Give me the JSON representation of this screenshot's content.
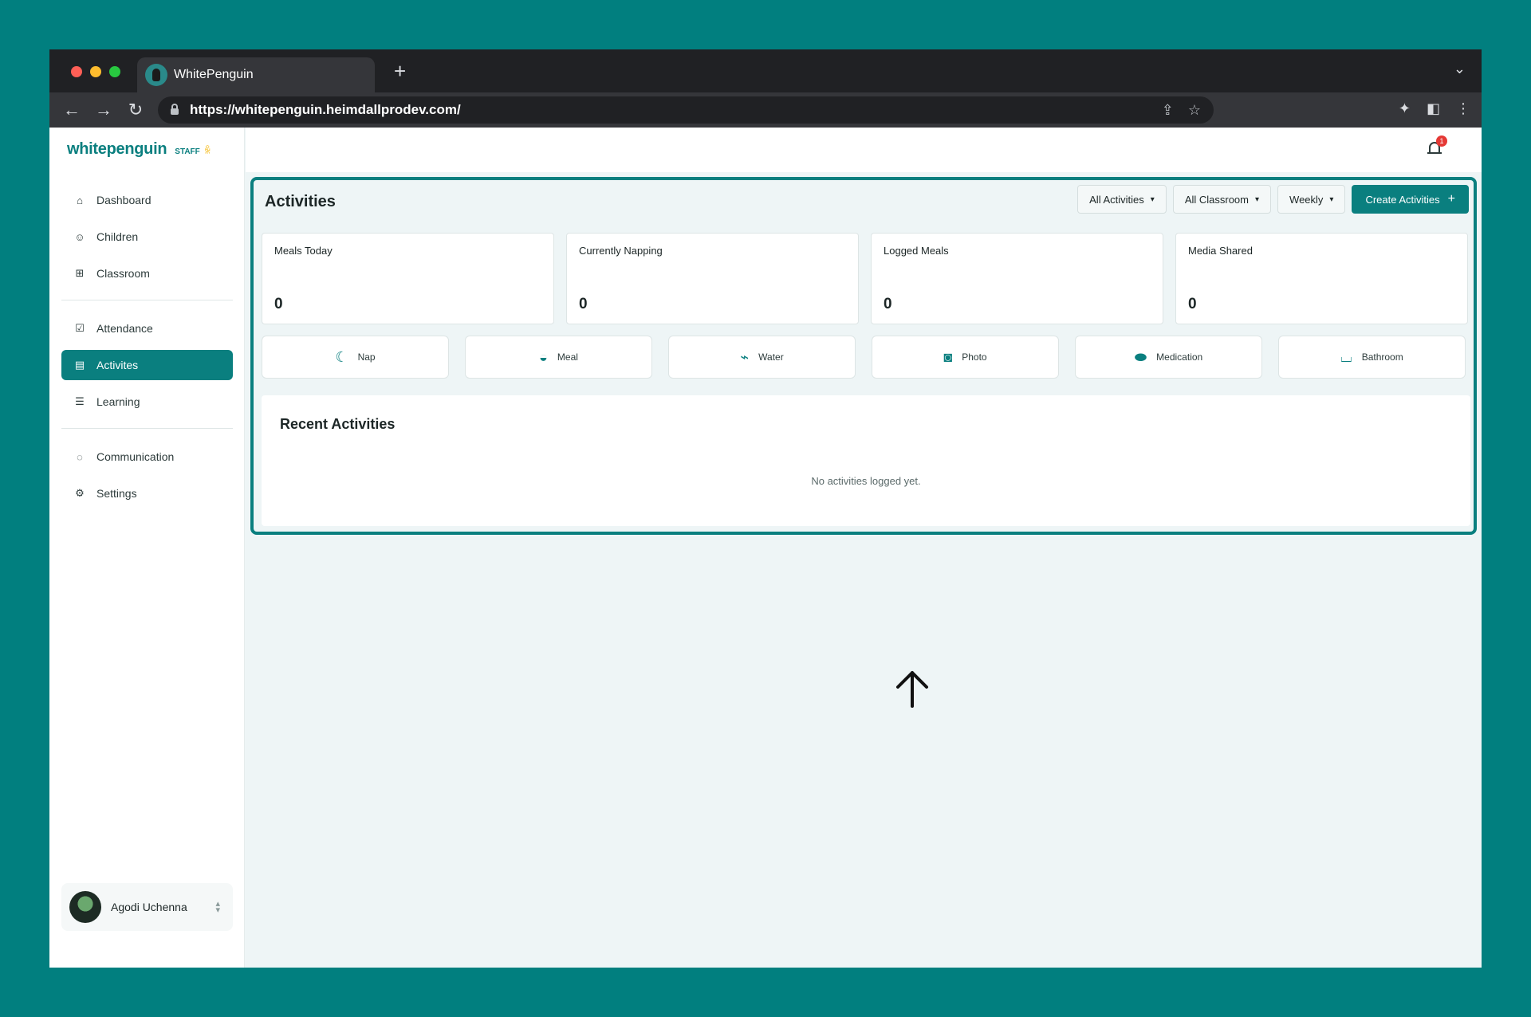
{
  "browser": {
    "tab_title": "WhitePenguin",
    "url": "https://whitepenguin.heimdallprodev.com/"
  },
  "brand": {
    "logo": "whitepenguin",
    "role": "STAFF",
    "accent": "#0a7f7f"
  },
  "sidebar": {
    "items": [
      {
        "label": "Dashboard",
        "icon": "home-icon"
      },
      {
        "label": "Children",
        "icon": "child-icon"
      },
      {
        "label": "Classroom",
        "icon": "grid-icon"
      },
      {
        "label": "Attendance",
        "icon": "checkbox-icon"
      },
      {
        "label": "Activites",
        "icon": "clipboard-icon",
        "active": true
      },
      {
        "label": "Learning",
        "icon": "book-icon"
      },
      {
        "label": "Communication",
        "icon": "chat-icon"
      },
      {
        "label": "Settings",
        "icon": "gear-icon"
      }
    ],
    "user": {
      "name": "Agodi Uchenna"
    }
  },
  "topbar": {
    "notification_count": "1"
  },
  "main": {
    "title": "Activities",
    "filters": {
      "activity": "All Activities",
      "classroom": "All Classroom",
      "period": "Weekly",
      "create_label": "Create Activities"
    },
    "stats": [
      {
        "label": "Meals Today",
        "value": "0"
      },
      {
        "label": "Currently Napping",
        "value": "0"
      },
      {
        "label": "Logged Meals",
        "value": "0"
      },
      {
        "label": "Media Shared",
        "value": "0"
      }
    ],
    "quick_actions": [
      {
        "label": "Nap",
        "icon": "moon-icon"
      },
      {
        "label": "Meal",
        "icon": "bowl-icon"
      },
      {
        "label": "Water",
        "icon": "bottle-icon"
      },
      {
        "label": "Photo",
        "icon": "camera-icon"
      },
      {
        "label": "Medication",
        "icon": "pill-icon"
      },
      {
        "label": "Bathroom",
        "icon": "bathtub-icon"
      }
    ],
    "recent": {
      "title": "Recent Activities",
      "empty": "No activities logged yet."
    }
  }
}
